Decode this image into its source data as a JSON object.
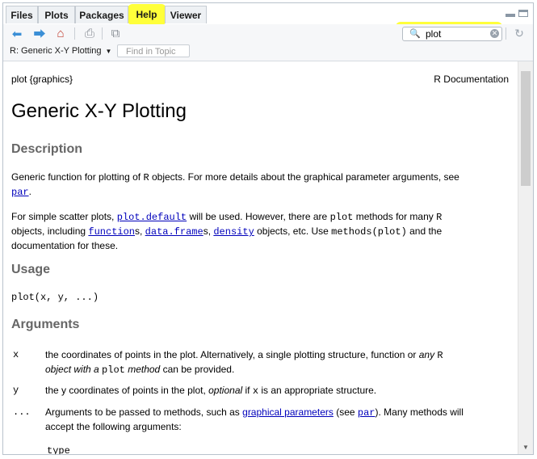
{
  "tabs": [
    {
      "label": "Files"
    },
    {
      "label": "Plots"
    },
    {
      "label": "Packages"
    },
    {
      "label": "Help"
    },
    {
      "label": "Viewer"
    }
  ],
  "search": {
    "value": "plot"
  },
  "topic": {
    "label": "R: Generic X-Y Plotting",
    "find_placeholder": "Find in Topic"
  },
  "doc": {
    "header_left": "plot {graphics}",
    "header_right": "R Documentation",
    "title": "Generic X-Y Plotting",
    "description_heading": "Description",
    "desc1_a": "Generic function for plotting of ",
    "desc1_r": "R",
    "desc1_b": " objects. For more details about the graphical parameter arguments, see",
    "desc1_link": "par",
    "desc1_c": ".",
    "desc2_a": "For simple scatter plots, ",
    "desc2_link1": "plot.default",
    "desc2_b": " will be used. However, there are ",
    "desc2_code": "plot",
    "desc2_c": " methods for many ",
    "desc2_r": "R",
    "desc2_d": "objects, including ",
    "desc2_link2": "function",
    "desc2_e": "s, ",
    "desc2_link3": "data.frame",
    "desc2_f": "s, ",
    "desc2_link4": "density",
    "desc2_g": " objects, etc. Use ",
    "desc2_code2": "methods(plot)",
    "desc2_h": " and the",
    "desc2_i": "documentation for these.",
    "usage_heading": "Usage",
    "usage_code": "plot(x, y, ...)",
    "arguments_heading": "Arguments",
    "arg_x_name": "x",
    "arg_x_a": "the coordinates of points in the plot. Alternatively, a single plotting structure, function or ",
    "arg_x_italic1": "any",
    "arg_x_r": "R",
    "arg_x_italic2": "object with a",
    "arg_x_code": "plot",
    "arg_x_italic3": "method",
    "arg_x_b": " can be provided.",
    "arg_y_name": "y",
    "arg_y_a": "the y coordinates of points in the plot, ",
    "arg_y_italic": "optional",
    "arg_y_b": " if ",
    "arg_y_code": "x",
    "arg_y_c": " is an appropriate structure.",
    "arg_dots_name": "...",
    "arg_dots_a": "Arguments to be passed to methods, such as ",
    "arg_dots_link": "graphical parameters",
    "arg_dots_b": " (see ",
    "arg_dots_link2": "par",
    "arg_dots_c": "). Many methods will",
    "arg_dots_d": "accept the following arguments:",
    "type_code": "type"
  },
  "colors": {
    "highlight": "#ffff3a",
    "link": "#0000bb",
    "heading": "#666666"
  },
  "icons": [
    "back-arrow-icon",
    "forward-arrow-icon",
    "home-icon",
    "print-icon",
    "popout-icon",
    "search-icon",
    "clear-icon",
    "refresh-icon"
  ]
}
